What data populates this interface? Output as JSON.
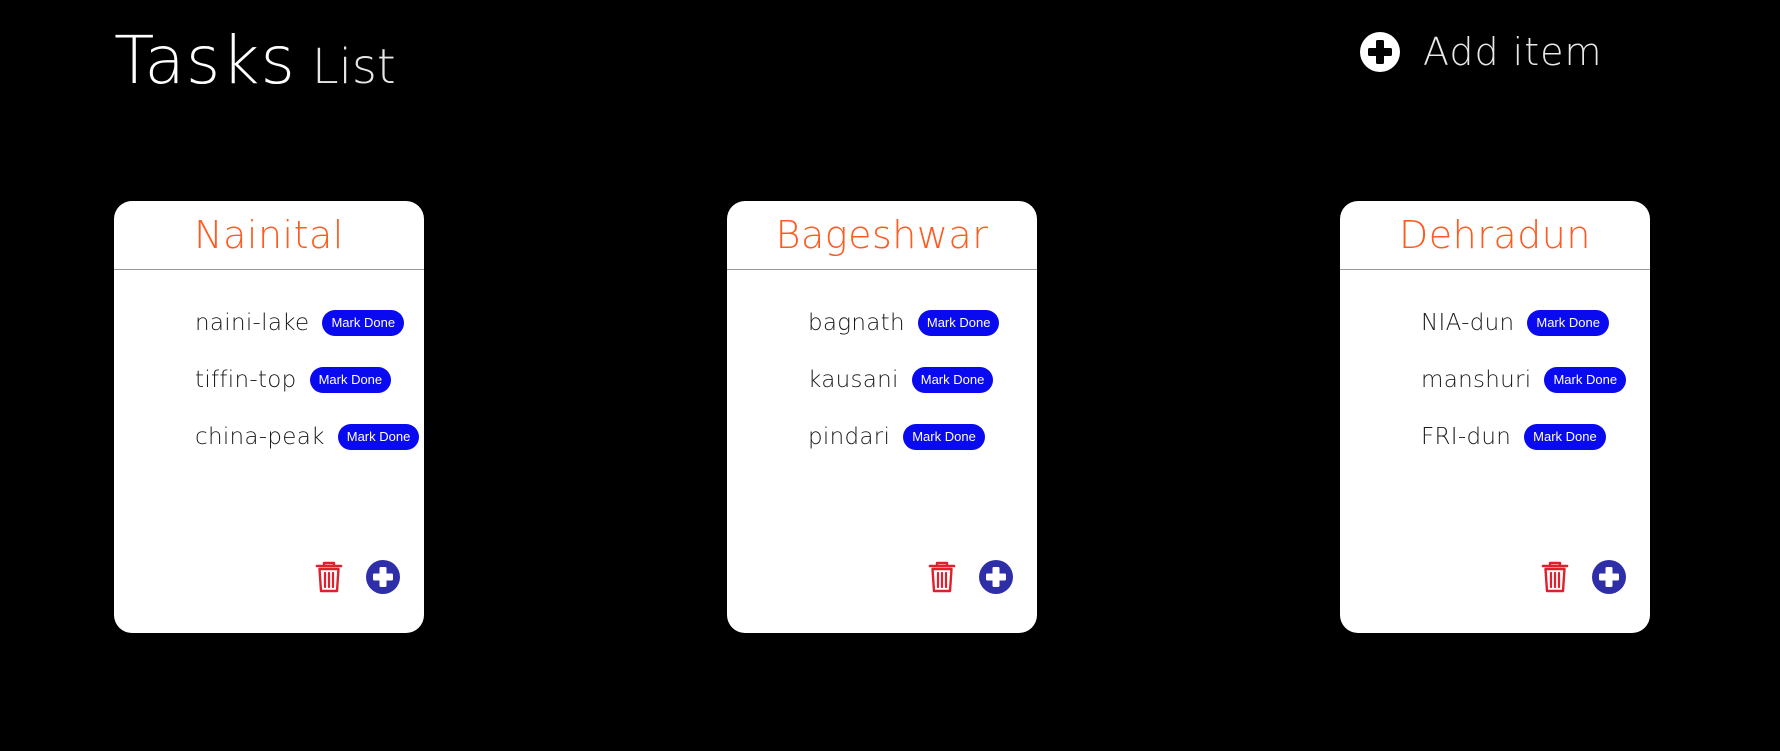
{
  "header": {
    "title_main": "Tasks",
    "title_sub": "List",
    "add_item_label": "Add item",
    "add_item_icon": "plus-circle-icon"
  },
  "colors": {
    "background": "#000000",
    "card_background": "#ffffff",
    "card_title": "#ff5a1f",
    "mark_done_button": "#0a0af0",
    "trash_icon": "#e0202c",
    "add_task_icon": "#2e2ea8"
  },
  "cards": [
    {
      "title": "Nainital",
      "tasks": [
        {
          "name": "naini-lake",
          "button": "Mark Done"
        },
        {
          "name": "tiffin-top",
          "button": "Mark Done"
        },
        {
          "name": "china-peak",
          "button": "Mark Done"
        }
      ],
      "delete_icon": "trash-icon",
      "add_icon": "plus-circle-icon"
    },
    {
      "title": "Bageshwar",
      "tasks": [
        {
          "name": "bagnath",
          "button": "Mark Done"
        },
        {
          "name": "kausani",
          "button": "Mark Done"
        },
        {
          "name": "pindari",
          "button": "Mark Done"
        }
      ],
      "delete_icon": "trash-icon",
      "add_icon": "plus-circle-icon"
    },
    {
      "title": "Dehradun",
      "tasks": [
        {
          "name": "NIA-dun",
          "button": "Mark Done"
        },
        {
          "name": "manshuri",
          "button": "Mark Done"
        },
        {
          "name": "FRI-dun",
          "button": "Mark Done"
        }
      ],
      "delete_icon": "trash-icon",
      "add_icon": "plus-circle-icon"
    }
  ]
}
